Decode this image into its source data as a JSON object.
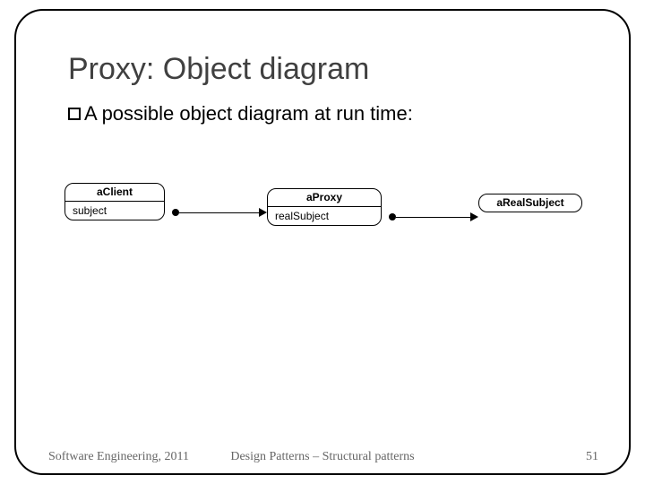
{
  "title": "Proxy: Object diagram",
  "bullet": "A possible object diagram at run time:",
  "objects": {
    "client": {
      "name": "aClient",
      "attr": "subject"
    },
    "proxy": {
      "name": "aProxy",
      "attr": "realSubject"
    },
    "real": {
      "name": "aRealSubject"
    }
  },
  "footer": {
    "left": "Software Engineering, 2011",
    "center": "Design Patterns – Structural patterns",
    "page": "51"
  }
}
